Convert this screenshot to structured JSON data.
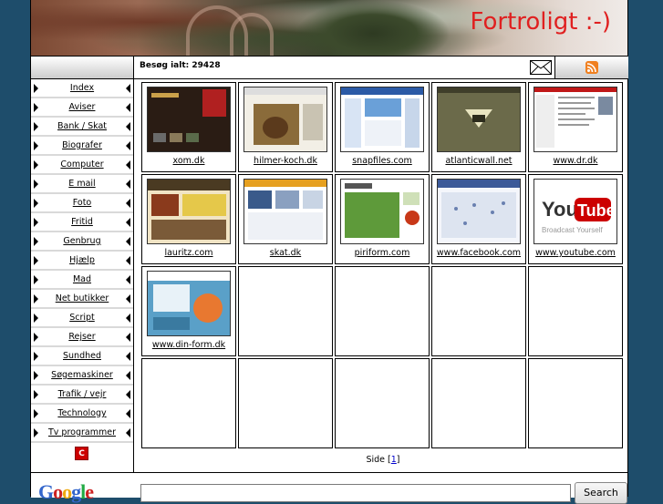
{
  "header": {
    "title": "Fortroligt :-)"
  },
  "infobar": {
    "visits": "Besøg ialt: 29428"
  },
  "nav": {
    "items": [
      {
        "label": "Index"
      },
      {
        "label": "Aviser"
      },
      {
        "label": "Bank / Skat"
      },
      {
        "label": "Biografer"
      },
      {
        "label": "Computer"
      },
      {
        "label": "E mail"
      },
      {
        "label": "Foto"
      },
      {
        "label": "Fritid"
      },
      {
        "label": "Genbrug"
      },
      {
        "label": "Hjælp"
      },
      {
        "label": "Mad"
      },
      {
        "label": "Net butikker"
      },
      {
        "label": "Script"
      },
      {
        "label": "Rejser"
      },
      {
        "label": "Sundhed"
      },
      {
        "label": "Søgemaskiner"
      },
      {
        "label": "Trafik / vejr"
      },
      {
        "label": "Technology"
      },
      {
        "label": "Tv programmer"
      }
    ],
    "logo_letter": "C"
  },
  "grid": {
    "cells": [
      {
        "caption": "xom.dk",
        "theme": "dark-photo"
      },
      {
        "caption": "hilmer-koch.dk",
        "theme": "dog"
      },
      {
        "caption": "snapfiles.com",
        "theme": "blue-site"
      },
      {
        "caption": "atlanticwall.net",
        "theme": "olive"
      },
      {
        "caption": "www.dr.dk",
        "theme": "news"
      },
      {
        "caption": "lauritz.com",
        "theme": "auction"
      },
      {
        "caption": "skat.dk",
        "theme": "gov"
      },
      {
        "caption": "piriform.com",
        "theme": "green"
      },
      {
        "caption": "www.facebook.com",
        "theme": "facebook"
      },
      {
        "caption": "www.youtube.com",
        "theme": "youtube",
        "logo_text": "You",
        "logo_text2": "Tube",
        "tagline": "Broadcast Yourself"
      },
      {
        "caption": "www.din-form.dk",
        "theme": "fitness"
      },
      {
        "caption": ""
      },
      {
        "caption": ""
      },
      {
        "caption": ""
      },
      {
        "caption": ""
      },
      {
        "caption": ""
      },
      {
        "caption": ""
      },
      {
        "caption": ""
      },
      {
        "caption": ""
      },
      {
        "caption": ""
      }
    ]
  },
  "pager": {
    "label": "Side",
    "page": "1"
  },
  "google": {
    "logo": "Google",
    "button": "Search"
  },
  "colors": {
    "accent_red": "#e02020",
    "page_bg": "#1e4d6b"
  }
}
